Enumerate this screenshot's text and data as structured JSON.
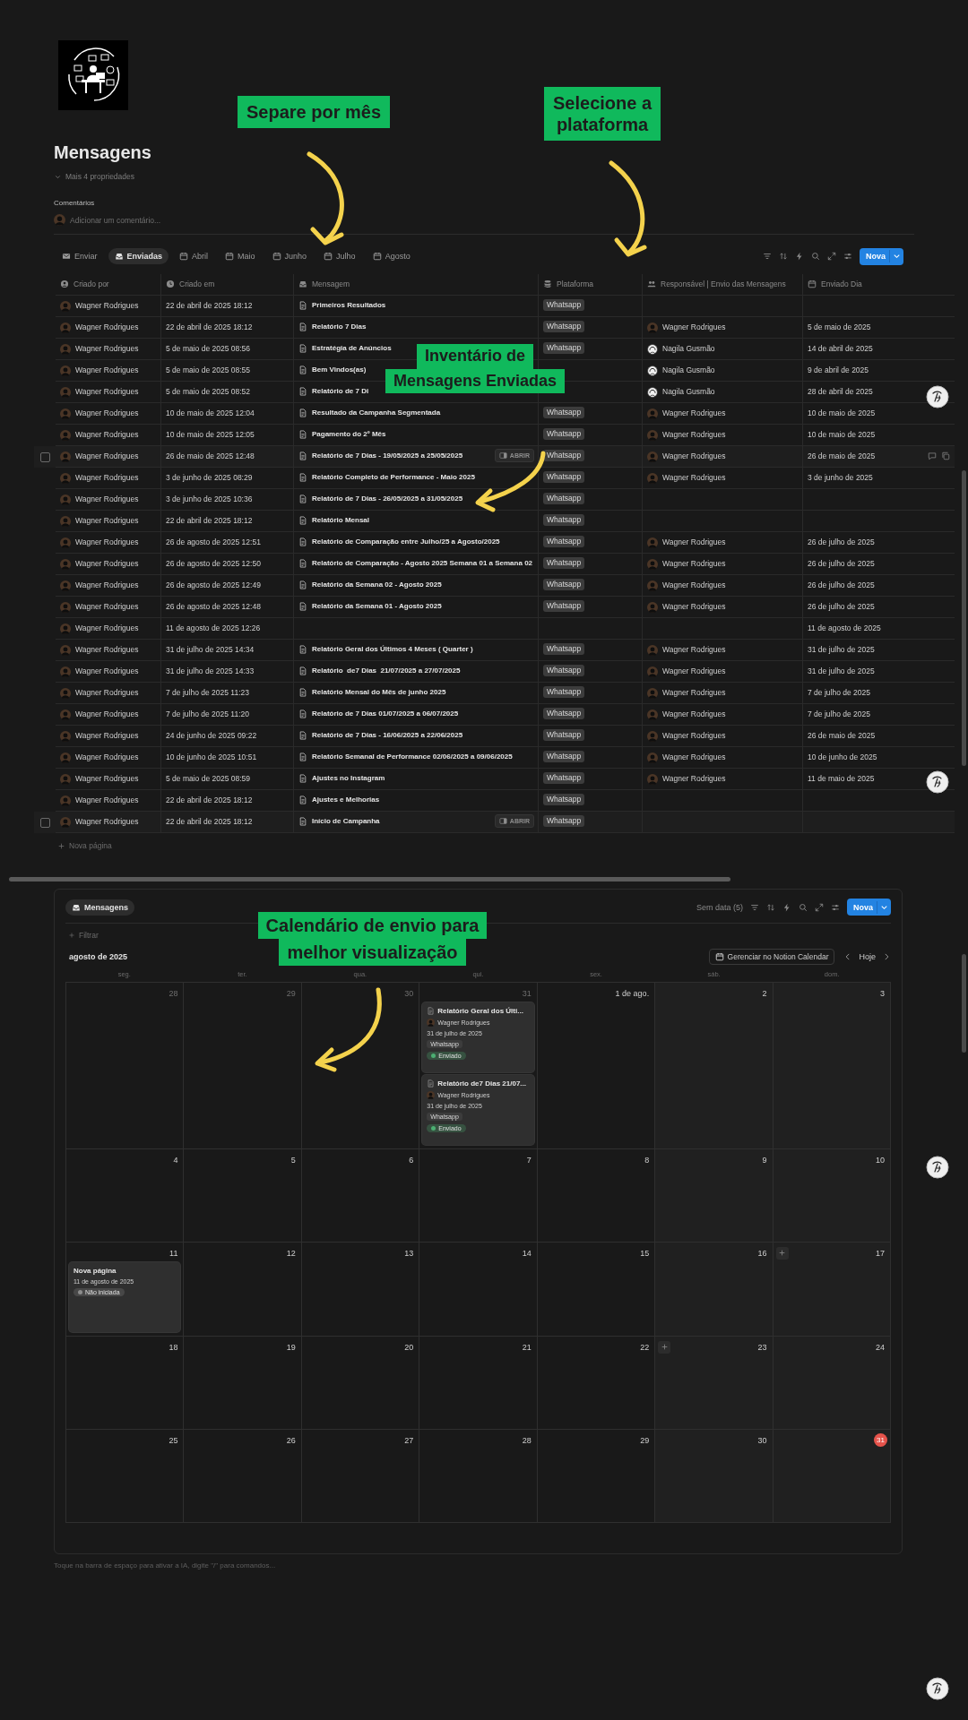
{
  "page": {
    "title": "Mensagens",
    "properties_toggle": "Mais 4 propriedades",
    "comments_label": "Comentários",
    "comment_placeholder": "Adicionar um comentário..."
  },
  "views": [
    {
      "label": "Enviar",
      "selected": false
    },
    {
      "label": "Enviadas",
      "selected": true
    },
    {
      "label": "Abril",
      "selected": false
    },
    {
      "label": "Maio",
      "selected": false
    },
    {
      "label": "Junho",
      "selected": false
    },
    {
      "label": "Julho",
      "selected": false
    },
    {
      "label": "Agosto",
      "selected": false
    }
  ],
  "toolbar": {
    "new_button": "Nova"
  },
  "table": {
    "columns": [
      "Criado por",
      "Criado em",
      "Mensagem",
      "Plataforma",
      "Responsável | Envio das Mensagens",
      "Enviado Dia"
    ],
    "rows": [
      {
        "created_by": "Wagner Rodrigues",
        "created_at": "22 de abril de 2025 18:12",
        "message": "Primeiros Resultados",
        "platform": "Whatsapp",
        "hovered": false
      },
      {
        "created_by": "Wagner Rodrigues",
        "created_at": "22 de abril de 2025 18:12",
        "message": "Relatório 7 Dias",
        "platform": "Whatsapp",
        "responsible": {
          "name": "Wagner Rodrigues",
          "kind": "dark"
        },
        "sent_day": "5 de maio de 2025",
        "hovered": false
      },
      {
        "created_by": "Wagner Rodrigues",
        "created_at": "5 de maio de 2025 08:56",
        "message": "Estratégia de Anúncios",
        "platform": "Whatsapp",
        "responsible": {
          "name": "Nagila Gusmão",
          "kind": "light"
        },
        "sent_day": "14 de abril de 2025",
        "hovered": false
      },
      {
        "created_by": "Wagner Rodrigues",
        "created_at": "5 de maio de 2025 08:55",
        "message": "Bem Vindos(as)",
        "responsible": {
          "name": "Nagila Gusmão",
          "kind": "light"
        },
        "sent_day": "9 de abril de 2025",
        "hovered": false
      },
      {
        "created_by": "Wagner Rodrigues",
        "created_at": "5 de maio de 2025 08:52",
        "message": "Relatório de 7 Di",
        "responsible": {
          "name": "Nagila Gusmão",
          "kind": "light"
        },
        "sent_day": "28 de abril de 2025",
        "hovered": false
      },
      {
        "created_by": "Wagner Rodrigues",
        "created_at": "10 de maio de 2025 12:04",
        "message": "Resultado da Campanha Segmentada",
        "platform": "Whatsapp",
        "responsible": {
          "name": "Wagner Rodrigues",
          "kind": "dark"
        },
        "sent_day": "10 de maio de 2025",
        "hovered": false
      },
      {
        "created_by": "Wagner Rodrigues",
        "created_at": "10 de maio de 2025 12:05",
        "message": "Pagamento do 2º Mês",
        "platform": "Whatsapp",
        "responsible": {
          "name": "Wagner Rodrigues",
          "kind": "dark"
        },
        "sent_day": "10 de maio de 2025",
        "hovered": false
      },
      {
        "created_by": "Wagner Rodrigues",
        "created_at": "26 de maio de 2025 12:48",
        "message": "Relatório de 7 Dias - 19/05/2025 a 25/05/2025",
        "open_button": "ABRIR",
        "platform": "Whatsapp",
        "responsible": {
          "name": "Wagner Rodrigues",
          "kind": "dark"
        },
        "sent_day": "26 de maio de 2025",
        "hovered": true
      },
      {
        "created_by": "Wagner Rodrigues",
        "created_at": "3 de junho de 2025 08:29",
        "message": "Relatório Completo de Performance - Maio 2025",
        "platform": "Whatsapp",
        "responsible": {
          "name": "Wagner Rodrigues",
          "kind": "dark"
        },
        "sent_day": "3 de junho de 2025",
        "hovered": false
      },
      {
        "created_by": "Wagner Rodrigues",
        "created_at": "3 de junho de 2025 10:36",
        "message": "Relatório de 7 Dias - 26/05/2025 a 31/05/2025",
        "platform": "Whatsapp",
        "hovered": false
      },
      {
        "created_by": "Wagner Rodrigues",
        "created_at": "22 de abril de 2025 18:12",
        "message": "Relatório Mensal",
        "platform": "Whatsapp",
        "hovered": false
      },
      {
        "created_by": "Wagner Rodrigues",
        "created_at": "26 de agosto de 2025 12:51",
        "message": "Relatório de Comparação entre Julho/25 a Agosto/2025",
        "platform": "Whatsapp",
        "responsible": {
          "name": "Wagner Rodrigues",
          "kind": "dark"
        },
        "sent_day": "26 de julho de 2025",
        "hovered": false
      },
      {
        "created_by": "Wagner Rodrigues",
        "created_at": "26 de agosto de 2025 12:50",
        "message": "Relatório de Comparação - Agosto 2025 Semana 01 a Semana 02",
        "platform": "Whatsapp",
        "responsible": {
          "name": "Wagner Rodrigues",
          "kind": "dark"
        },
        "sent_day": "26 de julho de 2025",
        "hovered": false
      },
      {
        "created_by": "Wagner Rodrigues",
        "created_at": "26 de agosto de 2025 12:49",
        "message": "Relatório da Semana 02 - Agosto 2025",
        "platform": "Whatsapp",
        "responsible": {
          "name": "Wagner Rodrigues",
          "kind": "dark"
        },
        "sent_day": "26 de julho de 2025",
        "hovered": false
      },
      {
        "created_by": "Wagner Rodrigues",
        "created_at": "26 de agosto de 2025 12:48",
        "message": "Relatório da Semana 01 - Agosto 2025",
        "platform": "Whatsapp",
        "responsible": {
          "name": "Wagner Rodrigues",
          "kind": "dark"
        },
        "sent_day": "26 de julho de 2025",
        "hovered": false
      },
      {
        "created_by": "Wagner Rodrigues",
        "created_at": "11 de agosto de 2025 12:26",
        "sent_day": "11 de agosto de 2025",
        "hovered": false
      },
      {
        "created_by": "Wagner Rodrigues",
        "created_at": "31 de julho de 2025 14:34",
        "message": "Relatório Geral dos Últimos 4 Meses ( Quarter )",
        "platform": "Whatsapp",
        "responsible": {
          "name": "Wagner Rodrigues",
          "kind": "dark"
        },
        "sent_day": "31 de julho de 2025",
        "hovered": false
      },
      {
        "created_by": "Wagner Rodrigues",
        "created_at": "31 de julho de 2025 14:33",
        "message": "Relatório  de7 Dias  21/07/2025 a 27/07/2025",
        "platform": "Whatsapp",
        "responsible": {
          "name": "Wagner Rodrigues",
          "kind": "dark"
        },
        "sent_day": "31 de julho de 2025",
        "hovered": false
      },
      {
        "created_by": "Wagner Rodrigues",
        "created_at": "7 de julho de 2025 11:23",
        "message": "Relatório Mensal do Mês de junho 2025",
        "platform": "Whatsapp",
        "responsible": {
          "name": "Wagner Rodrigues",
          "kind": "dark"
        },
        "sent_day": "7 de julho de 2025",
        "hovered": false
      },
      {
        "created_by": "Wagner Rodrigues",
        "created_at": "7 de julho de 2025 11:20",
        "message": "Relatório de 7 Dias 01/07/2025 a 06/07/2025",
        "platform": "Whatsapp",
        "responsible": {
          "name": "Wagner Rodrigues",
          "kind": "dark"
        },
        "sent_day": "7 de julho de 2025",
        "hovered": false
      },
      {
        "created_by": "Wagner Rodrigues",
        "created_at": "24 de junho de 2025 09:22",
        "message": "Relatório de 7 Dias - 16/06/2025 a 22/06/2025",
        "platform": "Whatsapp",
        "responsible": {
          "name": "Wagner Rodrigues",
          "kind": "dark"
        },
        "sent_day": "26 de maio de 2025",
        "hovered": false
      },
      {
        "created_by": "Wagner Rodrigues",
        "created_at": "10 de junho de 2025 10:51",
        "message": "Relatório Semanal de Performance 02/06/2025 a 09/06/2025",
        "platform": "Whatsapp",
        "responsible": {
          "name": "Wagner Rodrigues",
          "kind": "dark"
        },
        "sent_day": "10 de junho de 2025",
        "hovered": false
      },
      {
        "created_by": "Wagner Rodrigues",
        "created_at": "5 de maio de 2025 08:59",
        "message": "Ajustes no Instagram",
        "platform": "Whatsapp",
        "responsible": {
          "name": "Wagner Rodrigues",
          "kind": "dark"
        },
        "sent_day": "11 de maio de 2025",
        "hovered": false
      },
      {
        "created_by": "Wagner Rodrigues",
        "created_at": "22 de abril de 2025 18:12",
        "message": "Ajustes e Melhorias",
        "platform": "Whatsapp",
        "hovered": false
      },
      {
        "created_by": "Wagner Rodrigues",
        "created_at": "22 de abril de 2025 18:12",
        "message": "Início de Campanha",
        "open_button": "ABRIR",
        "platform": "Whatsapp",
        "hovered": true
      }
    ],
    "new_page": "Nova página"
  },
  "calendar": {
    "view_tab": "Mensagens",
    "no_date": "Sem data (5)",
    "new_button": "Nova",
    "filter": "Filtrar",
    "month": "agosto de 2025",
    "manage_button": "Gerenciar no Notion Calendar",
    "today_button": "Hoje",
    "weekdays": [
      "seg.",
      "ter.",
      "qua.",
      "qui.",
      "sex.",
      "sáb.",
      "dom."
    ],
    "weeks": [
      [
        {
          "day": "28",
          "outside": true,
          "today": false,
          "add": false
        },
        {
          "day": "29",
          "outside": true,
          "today": false,
          "add": false
        },
        {
          "day": "30",
          "outside": true,
          "today": false,
          "add": false
        },
        {
          "day": "31",
          "outside": true,
          "today": false,
          "add": false,
          "events": [
            {
              "kind": "page",
              "title": "Relatório Geral dos Últi...",
              "person": "Wagner Rodrigues",
              "date": "31 de julho de 2025",
              "platform": "Whatsapp",
              "status": {
                "label": "Enviado",
                "color": "#4caf72"
              }
            },
            {
              "kind": "page",
              "title": "Relatório de7 Dias 21/07...",
              "person": "Wagner Rodrigues",
              "date": "31 de julho de 2025",
              "platform": "Whatsapp",
              "status": {
                "label": "Enviado",
                "color": "#4caf72"
              }
            }
          ]
        },
        {
          "day": "1 de ago.",
          "outside": false,
          "today": false,
          "add": false
        },
        {
          "day": "2",
          "outside": false,
          "today": false,
          "add": false
        },
        {
          "day": "3",
          "outside": false,
          "today": false,
          "add": false
        }
      ],
      [
        {
          "day": "4",
          "outside": false,
          "today": false,
          "add": false
        },
        {
          "day": "5",
          "outside": false,
          "today": false,
          "add": false
        },
        {
          "day": "6",
          "outside": false,
          "today": false,
          "add": false
        },
        {
          "day": "7",
          "outside": false,
          "today": false,
          "add": false
        },
        {
          "day": "8",
          "outside": false,
          "today": false,
          "add": false
        },
        {
          "day": "9",
          "outside": false,
          "today": false,
          "add": false
        },
        {
          "day": "10",
          "outside": false,
          "today": false,
          "add": false
        }
      ],
      [
        {
          "day": "11",
          "outside": false,
          "today": false,
          "add": false,
          "events": [
            {
              "kind": "draft",
              "title": "Nova página",
              "date": "11 de agosto de 2025",
              "status": {
                "label": "Não iniciada",
                "color": "#8c8c8c"
              }
            }
          ]
        },
        {
          "day": "12",
          "outside": false,
          "today": false,
          "add": false
        },
        {
          "day": "13",
          "outside": false,
          "today": false,
          "add": false
        },
        {
          "day": "14",
          "outside": false,
          "today": false,
          "add": false
        },
        {
          "day": "15",
          "outside": false,
          "today": false,
          "add": false
        },
        {
          "day": "16",
          "outside": false,
          "today": false,
          "add": false
        },
        {
          "day": "17",
          "outside": false,
          "today": false,
          "add": true
        }
      ],
      [
        {
          "day": "18",
          "outside": false,
          "today": false,
          "add": false
        },
        {
          "day": "19",
          "outside": false,
          "today": false,
          "add": false
        },
        {
          "day": "20",
          "outside": false,
          "today": false,
          "add": false
        },
        {
          "day": "21",
          "outside": false,
          "today": false,
          "add": false
        },
        {
          "day": "22",
          "outside": false,
          "today": false,
          "add": false
        },
        {
          "day": "23",
          "outside": false,
          "today": false,
          "add": true
        },
        {
          "day": "24",
          "outside": false,
          "today": false,
          "add": false
        }
      ],
      [
        {
          "day": "25",
          "outside": false,
          "today": false,
          "add": false
        },
        {
          "day": "26",
          "outside": false,
          "today": false,
          "add": false
        },
        {
          "day": "27",
          "outside": false,
          "today": false,
          "add": false
        },
        {
          "day": "28",
          "outside": false,
          "today": false,
          "add": false
        },
        {
          "day": "29",
          "outside": false,
          "today": false,
          "add": false
        },
        {
          "day": "30",
          "outside": false,
          "today": false,
          "add": false
        },
        {
          "day": "31",
          "outside": false,
          "today": true,
          "add": false
        }
      ]
    ]
  },
  "footer_hint": "Toque na barra de espaço para ativar a IA, digite \"/\" para comandos...",
  "annotations": [
    {
      "kind": "box",
      "lines": [
        "Separe por mês"
      ]
    },
    {
      "kind": "box",
      "lines": [
        "Selecione a",
        "plataforma"
      ]
    },
    {
      "kind": "strips",
      "lines": [
        "Inventário de",
        "Mensagens Enviadas"
      ]
    },
    {
      "kind": "strips",
      "lines": [
        "Calendário de envio para",
        "melhor visualização"
      ]
    }
  ]
}
